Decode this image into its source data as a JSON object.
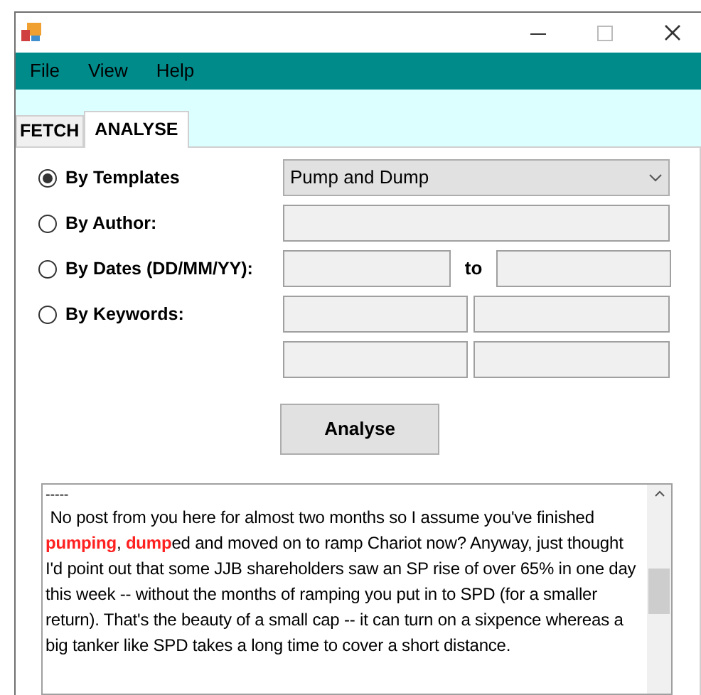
{
  "menu": [
    "File",
    "View",
    "Help"
  ],
  "tabs": [
    {
      "label": "FETCH",
      "selected": false
    },
    {
      "label": "ANALYSE",
      "selected": true
    }
  ],
  "options": [
    {
      "label": "By Templates",
      "selected": true,
      "kind": "dropdown",
      "value": "Pump and Dump"
    },
    {
      "label": "By Author:",
      "selected": false,
      "kind": "text"
    },
    {
      "label": "By Dates (DD/MM/YY):",
      "selected": false,
      "kind": "range",
      "separator": "to"
    },
    {
      "label": "By Keywords:",
      "selected": false,
      "kind": "grid"
    }
  ],
  "analyse_button": "Analyse",
  "result": {
    "separator": "-----",
    "segments": [
      {
        "text": " No post from you here for almost two months so I assume you've finished ",
        "highlight": false
      },
      {
        "text": "pumping",
        "highlight": true
      },
      {
        "text": ", ",
        "highlight": false
      },
      {
        "text": "dump",
        "highlight": true
      },
      {
        "text": "ed and moved on to ramp Chariot now? Anyway, just thought I'd point out that some JJB shareholders saw an SP rise of over 65% in one day this week -- without the months of ramping you put in to SPD (for a smaller return). That's the beauty of a small cap -- it can turn on a sixpence whereas a big tanker like SPD takes a long time to cover a short distance.",
        "highlight": false
      }
    ]
  }
}
